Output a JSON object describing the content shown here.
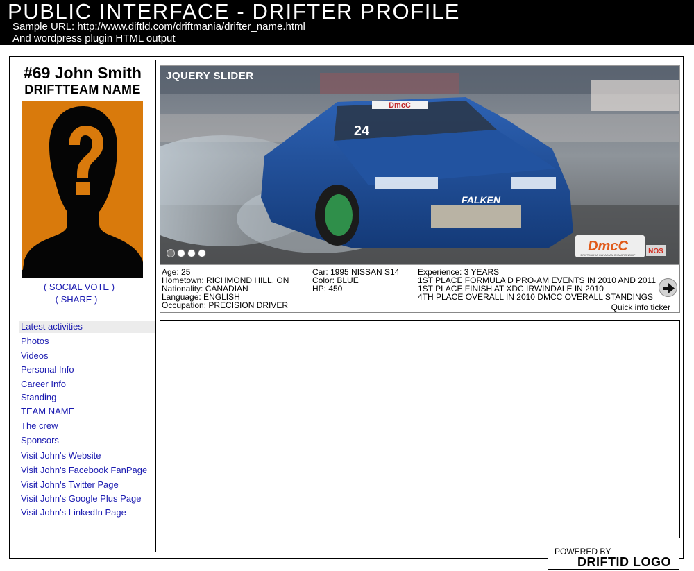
{
  "header": {
    "title": "PUBLIC INTERFACE - DRIFTER PROFILE",
    "sample_url": "Sample URL: http://www.diftld.com/driftmania/drifter_name.html",
    "subtitle": "And wordpress plugin HTML output"
  },
  "profile": {
    "name": "#69 John Smith",
    "team": "DRIFTTEAM NAME",
    "social_vote": "( SOCIAL VOTE )",
    "share": "( SHARE )"
  },
  "nav": {
    "items": [
      "Latest activities",
      "Photos",
      "Videos",
      "Personal Info",
      "Career Info",
      "Standing",
      "TEAM NAME",
      "The crew",
      "Sponsors",
      "Visit John's Website",
      "Visit John's Facebook FanPage",
      "Visit John's Twitter Page",
      "Visit John's Google Plus Page",
      "Visit John's LinkedIn Page"
    ]
  },
  "slider": {
    "label": "JQUERY SLIDER",
    "car_number": "24",
    "banner_text": "DmcC",
    "hood_text": "FALKEN",
    "logo_text": "DmcC",
    "logo_sub": "DRIFT MANIA CANADIAN CHAMPIONSHIP",
    "nos_text": "NOS"
  },
  "info": {
    "personal": [
      "Age: 25",
      "Hometown: RICHMOND HILL, ON",
      "Nationality: CANADIAN",
      "Language: ENGLISH",
      "Occupation: PRECISION DRIVER"
    ],
    "car": [
      "Car: 1995 NISSAN S14",
      "Color: BLUE",
      "HP: 450"
    ],
    "experience": [
      "Experience: 3 YEARS",
      "1ST PLACE FORMULA D PRO-AM EVENTS IN 2010 AND 2011",
      "1ST PLACE FINISH AT XDC IRWINDALE IN 2010",
      "4TH PLACE OVERALL IN 2010 DMCC OVERALL STANDINGS"
    ],
    "ticker_label": "Quick info ticker"
  },
  "footer": {
    "powered_by": "POWERED BY",
    "logo": "DRIFTID LOGO"
  },
  "colors": {
    "header_bg": "#000000",
    "link": "#1a1ab0",
    "avatar_bg": "#d97a0c",
    "car_blue": "#1f4f96"
  }
}
